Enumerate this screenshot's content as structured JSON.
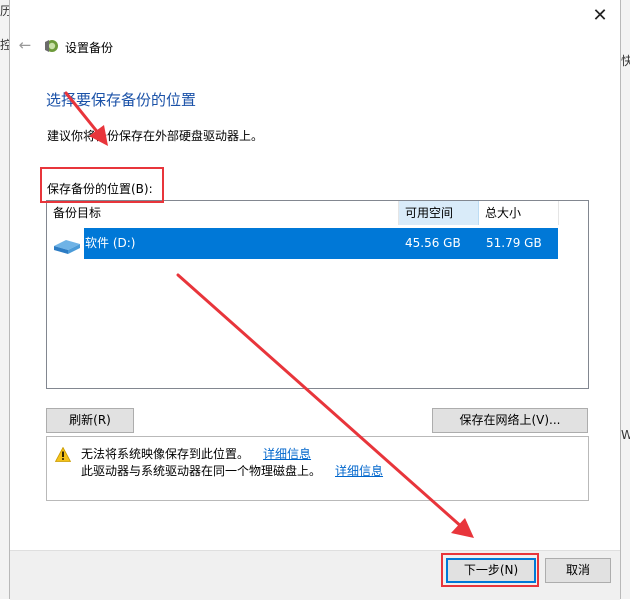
{
  "background": {
    "left_fragments": [
      "历",
      "控"
    ],
    "right_fragments": [
      "快",
      "W"
    ]
  },
  "window": {
    "title": "设置备份",
    "icons": {
      "close": "close-icon",
      "back": "back-arrow-icon",
      "app": "windows-backup-icon"
    }
  },
  "main": {
    "heading": "选择要保存备份的位置",
    "advice": "建议你将备份保存在外部硬盘驱动器上。",
    "location_label": "保存备份的位置(B):"
  },
  "list": {
    "columns": [
      "备份目标",
      "可用空间",
      "总大小"
    ],
    "rows": [
      {
        "name": "软件 (D:)",
        "free": "45.56 GB",
        "total": "51.79 GB",
        "selected": true
      }
    ]
  },
  "buttons": {
    "refresh": "刷新(R)",
    "save_network": "保存在网络上(V)...",
    "next": "下一步(N)",
    "cancel": "取消"
  },
  "warning": {
    "line1": "无法将系统映像保存到此位置。",
    "line1_link": "详细信息",
    "line2": "此驱动器与系统驱动器在同一个物理磁盘上。",
    "line2_link": "详细信息"
  },
  "colors": {
    "heading": "#1b52a8",
    "selection": "#0078d7",
    "annotation": "#e8353b",
    "link": "#0066cc"
  }
}
